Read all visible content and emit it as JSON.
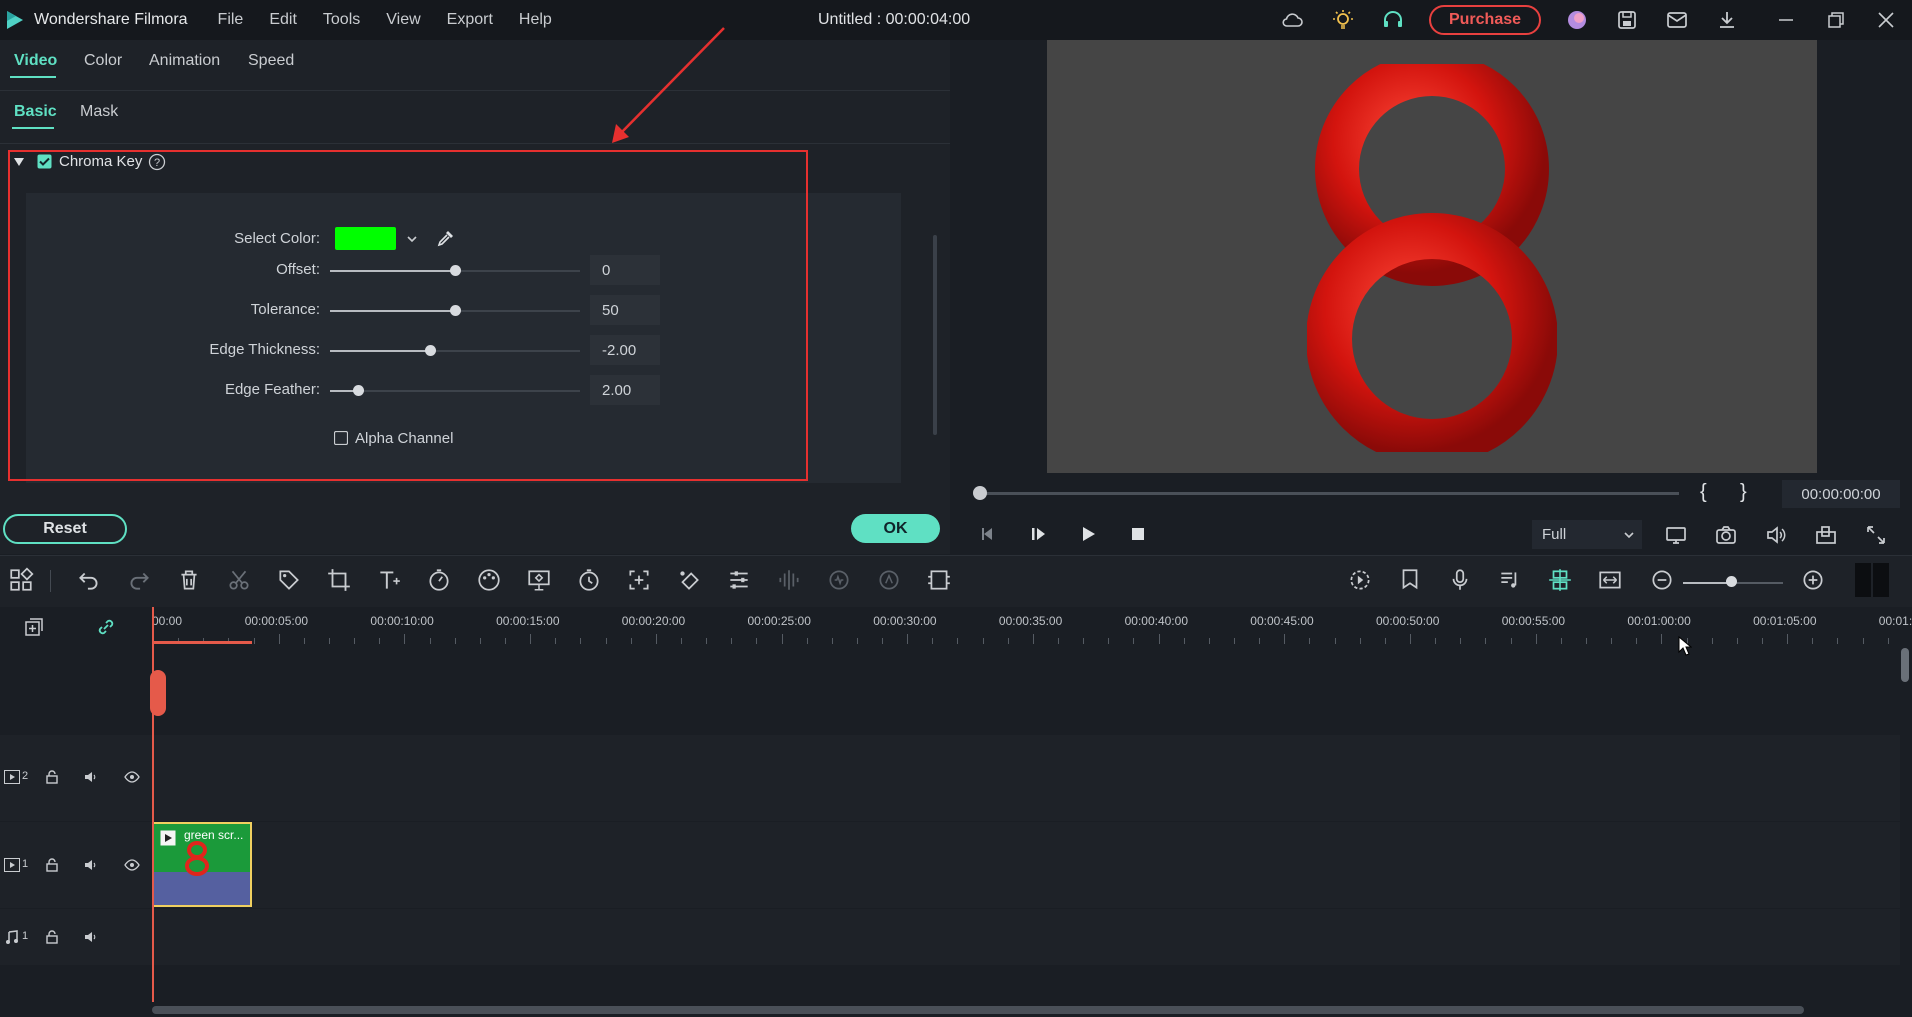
{
  "titlebar": {
    "app_name": "Wondershare Filmora",
    "menus": [
      "File",
      "Edit",
      "Tools",
      "View",
      "Export",
      "Help"
    ],
    "doc_title": "Untitled : 00:00:04:00",
    "purchase_label": "Purchase",
    "accent": "#e8403f"
  },
  "panel": {
    "tabs": [
      "Video",
      "Color",
      "Animation",
      "Speed"
    ],
    "subtabs": [
      "Basic",
      "Mask"
    ],
    "section_title": "Chroma Key",
    "select_color_label": "Select Color:",
    "key_color": "#00ff00",
    "sliders": [
      {
        "label": "Offset:",
        "value": "0",
        "fraction": 0.5
      },
      {
        "label": "Tolerance:",
        "value": "50",
        "fraction": 0.5
      },
      {
        "label": "Edge Thickness:",
        "value": "-2.00",
        "fraction": 0.4
      },
      {
        "label": "Edge Feather:",
        "value": "2.00",
        "fraction": 0.11
      }
    ],
    "alpha_channel_label": "Alpha Channel",
    "reset_label": "Reset",
    "ok_label": "OK"
  },
  "preview": {
    "big_number": "8",
    "timecode": "00:00:00:00",
    "zoom": "Full",
    "in_mark": "{",
    "out_mark": "}"
  },
  "timeline": {
    "ruler": [
      "00:00",
      "00:00:05:00",
      "00:00:10:00",
      "00:00:15:00",
      "00:00:20:00",
      "00:00:25:00",
      "00:00:30:00",
      "00:00:35:00",
      "00:00:40:00",
      "00:00:45:00",
      "00:00:50:00",
      "00:00:55:00",
      "00:01:00:00",
      "00:01:05:00",
      "00:01:1"
    ],
    "track_v2_num": "2",
    "track_v1_num": "1",
    "track_a1_num": "1",
    "clip_name": "green scr..."
  }
}
